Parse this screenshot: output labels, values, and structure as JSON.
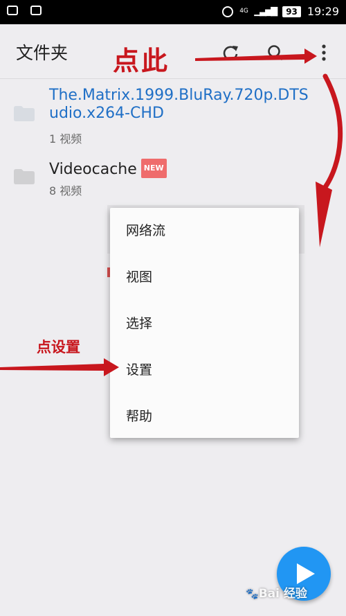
{
  "status_bar": {
    "battery": "93",
    "network_label": "4G",
    "time": "19:29"
  },
  "toolbar": {
    "title": "文件夹",
    "icons": [
      "refresh-icon",
      "search-icon",
      "more-vert-icon"
    ]
  },
  "folders": [
    {
      "name": "The.Matrix.1999.BluRay.720p.DTS-udio.x264-CHD",
      "name_line1": "The.Matrix.1999.BluRay.720p.DTS",
      "name_line2": "udio.x264-CHD",
      "count": "1 视频"
    },
    {
      "name": "Videocache",
      "badge": "NEW",
      "count": "8 视频"
    }
  ],
  "menu": {
    "items": [
      "网络流",
      "视图",
      "选择",
      "设置",
      "帮助"
    ]
  },
  "annotations": {
    "top": "点此",
    "settings": "点设置"
  },
  "watermark": "Bai 经验",
  "colors": {
    "accent": "#2196f3",
    "link": "#1f6fc6",
    "annotation": "#c8171e",
    "badge": "#ef6c6c"
  }
}
